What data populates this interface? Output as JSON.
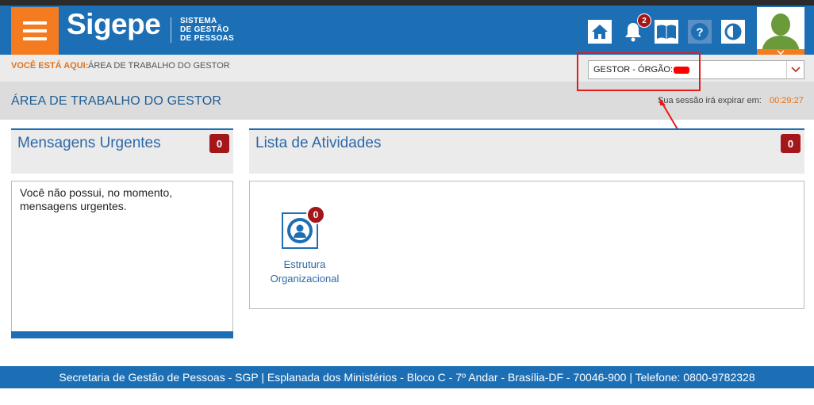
{
  "header": {
    "logo": "Sigepe",
    "logo_sub": [
      "SISTEMA",
      "DE GESTÃO",
      "DE PESSOAS"
    ],
    "notifications_count": "2",
    "icons": [
      "menu-icon",
      "home-icon",
      "bell-icon",
      "book-icon",
      "help-icon",
      "contrast-icon",
      "user-avatar-icon"
    ],
    "help_glyph": "?"
  },
  "breadcrumb": {
    "label": "VOCÊ ESTÁ AQUI:",
    "value": "ÁREA DE TRABALHO DO GESTOR"
  },
  "profile_select": {
    "value": "GESTOR - ÓRGÃO:"
  },
  "page": {
    "title": "ÁREA DE TRABALHO DO GESTOR",
    "session_text": "Sua sessão irá expirar em:",
    "session_time": "00:29:27"
  },
  "urgent_messages": {
    "title": "Mensagens Urgentes",
    "count": "0",
    "empty_text": "Você não possui, no momento, mensagens urgentes."
  },
  "activities": {
    "title": "Lista de Atividades",
    "count": "0",
    "items": [
      {
        "label": "Estrutura Organizacional",
        "count": "0",
        "icon": "person-circle-icon"
      }
    ]
  },
  "footer": {
    "text": "Secretaria de Gestão de Pessoas - SGP | Esplanada dos Ministérios - Bloco C - 7º Andar - Brasília-DF - 70046-900 | Telefone: 0800-9782328"
  },
  "colors": {
    "primary": "#1d6fb5",
    "accent": "#f57b20",
    "badge": "#a3171b",
    "annotation": "#e41b1b"
  }
}
